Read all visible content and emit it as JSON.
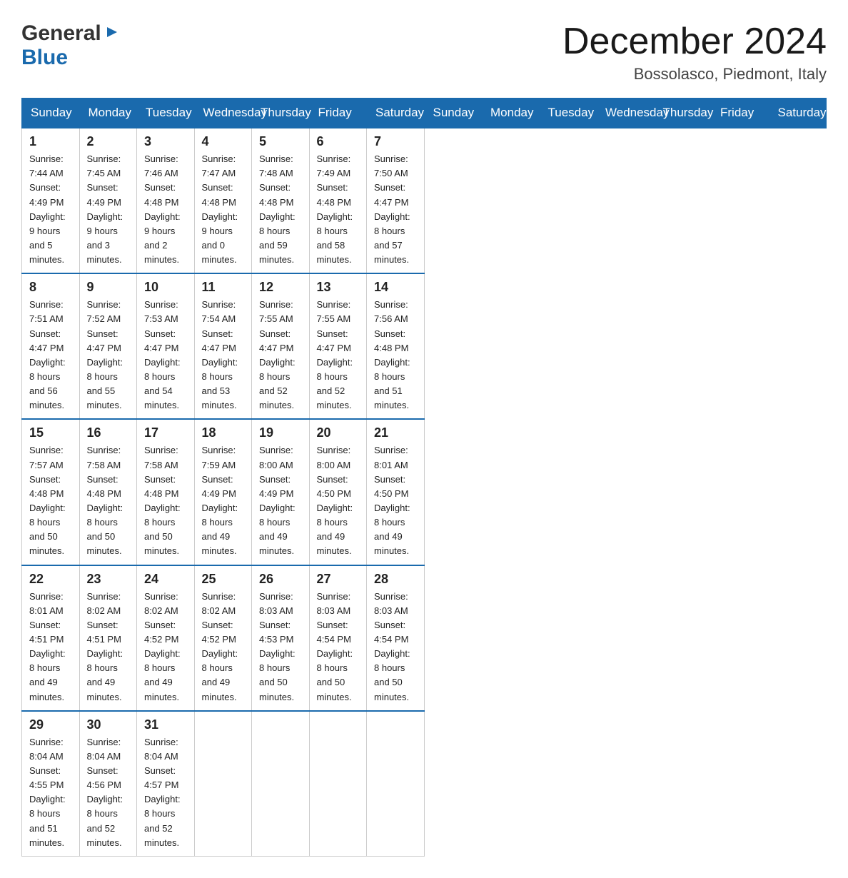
{
  "header": {
    "logo_general": "General",
    "logo_arrow": "▶",
    "logo_blue": "Blue",
    "month_title": "December 2024",
    "location": "Bossolasco, Piedmont, Italy"
  },
  "days_of_week": [
    "Sunday",
    "Monday",
    "Tuesday",
    "Wednesday",
    "Thursday",
    "Friday",
    "Saturday"
  ],
  "weeks": [
    [
      {
        "day": "1",
        "sunrise": "Sunrise: 7:44 AM",
        "sunset": "Sunset: 4:49 PM",
        "daylight": "Daylight: 9 hours",
        "daylight2": "and 5 minutes."
      },
      {
        "day": "2",
        "sunrise": "Sunrise: 7:45 AM",
        "sunset": "Sunset: 4:49 PM",
        "daylight": "Daylight: 9 hours",
        "daylight2": "and 3 minutes."
      },
      {
        "day": "3",
        "sunrise": "Sunrise: 7:46 AM",
        "sunset": "Sunset: 4:48 PM",
        "daylight": "Daylight: 9 hours",
        "daylight2": "and 2 minutes."
      },
      {
        "day": "4",
        "sunrise": "Sunrise: 7:47 AM",
        "sunset": "Sunset: 4:48 PM",
        "daylight": "Daylight: 9 hours",
        "daylight2": "and 0 minutes."
      },
      {
        "day": "5",
        "sunrise": "Sunrise: 7:48 AM",
        "sunset": "Sunset: 4:48 PM",
        "daylight": "Daylight: 8 hours",
        "daylight2": "and 59 minutes."
      },
      {
        "day": "6",
        "sunrise": "Sunrise: 7:49 AM",
        "sunset": "Sunset: 4:48 PM",
        "daylight": "Daylight: 8 hours",
        "daylight2": "and 58 minutes."
      },
      {
        "day": "7",
        "sunrise": "Sunrise: 7:50 AM",
        "sunset": "Sunset: 4:47 PM",
        "daylight": "Daylight: 8 hours",
        "daylight2": "and 57 minutes."
      }
    ],
    [
      {
        "day": "8",
        "sunrise": "Sunrise: 7:51 AM",
        "sunset": "Sunset: 4:47 PM",
        "daylight": "Daylight: 8 hours",
        "daylight2": "and 56 minutes."
      },
      {
        "day": "9",
        "sunrise": "Sunrise: 7:52 AM",
        "sunset": "Sunset: 4:47 PM",
        "daylight": "Daylight: 8 hours",
        "daylight2": "and 55 minutes."
      },
      {
        "day": "10",
        "sunrise": "Sunrise: 7:53 AM",
        "sunset": "Sunset: 4:47 PM",
        "daylight": "Daylight: 8 hours",
        "daylight2": "and 54 minutes."
      },
      {
        "day": "11",
        "sunrise": "Sunrise: 7:54 AM",
        "sunset": "Sunset: 4:47 PM",
        "daylight": "Daylight: 8 hours",
        "daylight2": "and 53 minutes."
      },
      {
        "day": "12",
        "sunrise": "Sunrise: 7:55 AM",
        "sunset": "Sunset: 4:47 PM",
        "daylight": "Daylight: 8 hours",
        "daylight2": "and 52 minutes."
      },
      {
        "day": "13",
        "sunrise": "Sunrise: 7:55 AM",
        "sunset": "Sunset: 4:47 PM",
        "daylight": "Daylight: 8 hours",
        "daylight2": "and 52 minutes."
      },
      {
        "day": "14",
        "sunrise": "Sunrise: 7:56 AM",
        "sunset": "Sunset: 4:48 PM",
        "daylight": "Daylight: 8 hours",
        "daylight2": "and 51 minutes."
      }
    ],
    [
      {
        "day": "15",
        "sunrise": "Sunrise: 7:57 AM",
        "sunset": "Sunset: 4:48 PM",
        "daylight": "Daylight: 8 hours",
        "daylight2": "and 50 minutes."
      },
      {
        "day": "16",
        "sunrise": "Sunrise: 7:58 AM",
        "sunset": "Sunset: 4:48 PM",
        "daylight": "Daylight: 8 hours",
        "daylight2": "and 50 minutes."
      },
      {
        "day": "17",
        "sunrise": "Sunrise: 7:58 AM",
        "sunset": "Sunset: 4:48 PM",
        "daylight": "Daylight: 8 hours",
        "daylight2": "and 50 minutes."
      },
      {
        "day": "18",
        "sunrise": "Sunrise: 7:59 AM",
        "sunset": "Sunset: 4:49 PM",
        "daylight": "Daylight: 8 hours",
        "daylight2": "and 49 minutes."
      },
      {
        "day": "19",
        "sunrise": "Sunrise: 8:00 AM",
        "sunset": "Sunset: 4:49 PM",
        "daylight": "Daylight: 8 hours",
        "daylight2": "and 49 minutes."
      },
      {
        "day": "20",
        "sunrise": "Sunrise: 8:00 AM",
        "sunset": "Sunset: 4:50 PM",
        "daylight": "Daylight: 8 hours",
        "daylight2": "and 49 minutes."
      },
      {
        "day": "21",
        "sunrise": "Sunrise: 8:01 AM",
        "sunset": "Sunset: 4:50 PM",
        "daylight": "Daylight: 8 hours",
        "daylight2": "and 49 minutes."
      }
    ],
    [
      {
        "day": "22",
        "sunrise": "Sunrise: 8:01 AM",
        "sunset": "Sunset: 4:51 PM",
        "daylight": "Daylight: 8 hours",
        "daylight2": "and 49 minutes."
      },
      {
        "day": "23",
        "sunrise": "Sunrise: 8:02 AM",
        "sunset": "Sunset: 4:51 PM",
        "daylight": "Daylight: 8 hours",
        "daylight2": "and 49 minutes."
      },
      {
        "day": "24",
        "sunrise": "Sunrise: 8:02 AM",
        "sunset": "Sunset: 4:52 PM",
        "daylight": "Daylight: 8 hours",
        "daylight2": "and 49 minutes."
      },
      {
        "day": "25",
        "sunrise": "Sunrise: 8:02 AM",
        "sunset": "Sunset: 4:52 PM",
        "daylight": "Daylight: 8 hours",
        "daylight2": "and 49 minutes."
      },
      {
        "day": "26",
        "sunrise": "Sunrise: 8:03 AM",
        "sunset": "Sunset: 4:53 PM",
        "daylight": "Daylight: 8 hours",
        "daylight2": "and 50 minutes."
      },
      {
        "day": "27",
        "sunrise": "Sunrise: 8:03 AM",
        "sunset": "Sunset: 4:54 PM",
        "daylight": "Daylight: 8 hours",
        "daylight2": "and 50 minutes."
      },
      {
        "day": "28",
        "sunrise": "Sunrise: 8:03 AM",
        "sunset": "Sunset: 4:54 PM",
        "daylight": "Daylight: 8 hours",
        "daylight2": "and 50 minutes."
      }
    ],
    [
      {
        "day": "29",
        "sunrise": "Sunrise: 8:04 AM",
        "sunset": "Sunset: 4:55 PM",
        "daylight": "Daylight: 8 hours",
        "daylight2": "and 51 minutes."
      },
      {
        "day": "30",
        "sunrise": "Sunrise: 8:04 AM",
        "sunset": "Sunset: 4:56 PM",
        "daylight": "Daylight: 8 hours",
        "daylight2": "and 52 minutes."
      },
      {
        "day": "31",
        "sunrise": "Sunrise: 8:04 AM",
        "sunset": "Sunset: 4:57 PM",
        "daylight": "Daylight: 8 hours",
        "daylight2": "and 52 minutes."
      },
      null,
      null,
      null,
      null
    ]
  ]
}
